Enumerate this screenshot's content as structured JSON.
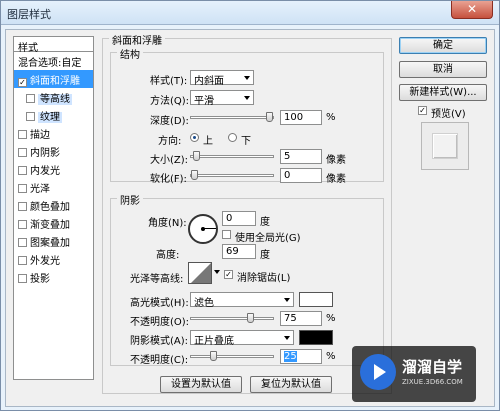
{
  "window": {
    "title": "图层样式",
    "close_glyph": "✕"
  },
  "sidebar": {
    "header": "样式",
    "items": [
      {
        "label": "混合选项:自定",
        "checkbox": false
      },
      {
        "label": "斜面和浮雕",
        "checkbox": true,
        "checked": true,
        "selected": true
      },
      {
        "label": "等高线",
        "checkbox": true,
        "checked": false,
        "sub": true
      },
      {
        "label": "纹理",
        "checkbox": true,
        "checked": false,
        "sub": true
      },
      {
        "label": "描边",
        "checkbox": true,
        "checked": false
      },
      {
        "label": "内阴影",
        "checkbox": true,
        "checked": false
      },
      {
        "label": "内发光",
        "checkbox": true,
        "checked": false
      },
      {
        "label": "光泽",
        "checkbox": true,
        "checked": false
      },
      {
        "label": "颜色叠加",
        "checkbox": true,
        "checked": false
      },
      {
        "label": "渐变叠加",
        "checkbox": true,
        "checked": false
      },
      {
        "label": "图案叠加",
        "checkbox": true,
        "checked": false
      },
      {
        "label": "外发光",
        "checkbox": true,
        "checked": false
      },
      {
        "label": "投影",
        "checkbox": true,
        "checked": false
      }
    ]
  },
  "bevel": {
    "group_title": "斜面和浮雕",
    "structure": {
      "title": "结构",
      "style_label": "样式(T):",
      "style_value": "内斜面",
      "method_label": "方法(Q):",
      "method_value": "平滑",
      "depth_label": "深度(D):",
      "depth_value": "100",
      "depth_unit": "%",
      "depth_pct": 100,
      "direction_label": "方向:",
      "dir_up": "上",
      "dir_down": "下",
      "size_label": "大小(Z):",
      "size_value": "5",
      "size_unit": "像素",
      "size_pct": 3,
      "soften_label": "软化(F):",
      "soften_value": "0",
      "soften_unit": "像素",
      "soften_pct": 0
    },
    "shading": {
      "title": "阴影",
      "angle_label": "角度(N):",
      "angle_value": "0",
      "angle_unit": "度",
      "global_light_label": "使用全局光(G)",
      "altitude_label": "高度:",
      "altitude_value": "69",
      "altitude_unit": "度",
      "gloss_label": "光泽等高线:",
      "antialias_label": "消除锯齿(L)",
      "highlight_label": "高光模式(H):",
      "highlight_value": "滤色",
      "highlight_color": "#ffffff",
      "hl_opacity_label": "不透明度(O):",
      "hl_opacity_value": "75",
      "hl_opacity_unit": "%",
      "hl_opacity_pct": 75,
      "shadow_label": "阴影模式(A):",
      "shadow_value": "正片叠底",
      "shadow_color": "#000000",
      "sh_opacity_label": "不透明度(C):",
      "sh_opacity_value": "25",
      "sh_opacity_unit": "%",
      "sh_opacity_pct": 25
    },
    "make_default": "设置为默认值",
    "reset_default": "复位为默认值"
  },
  "actions": {
    "ok": "确定",
    "cancel": "取消",
    "new_style": "新建样式(W)...",
    "preview_label": "预览(V)",
    "preview_checked": true
  },
  "watermark": {
    "brand": "溜溜自学",
    "url": "ZIXUE.3D66.COM"
  }
}
